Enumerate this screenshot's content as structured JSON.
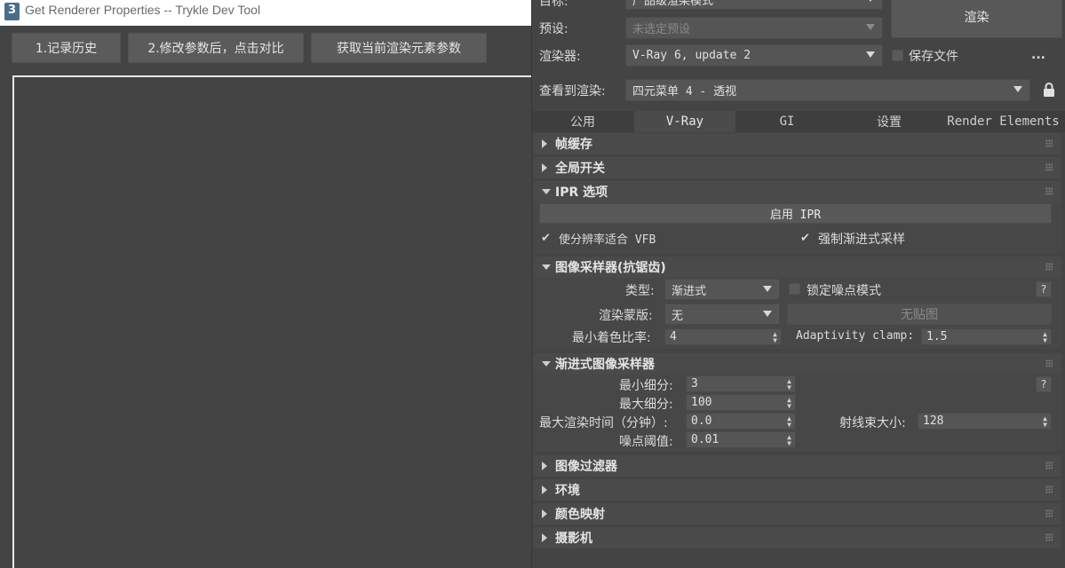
{
  "tool": {
    "title": "Get Renderer Properties -- Trykle Dev Tool",
    "buttons": [
      "1.记录历史",
      "2.修改参数后，点击对比",
      "获取当前渲染元素参数"
    ]
  },
  "render": {
    "target_label": "目标:",
    "target_value": "产品级渲染模式",
    "preset_label": "预设:",
    "preset_value": "未选定预设",
    "renderer_label": "渲染器:",
    "renderer_value": "V-Ray 6, update 2",
    "render_button": "渲染",
    "save_file_label": "保存文件",
    "more_label": "...",
    "view_label": "查看到渲染:",
    "view_value": "四元菜单 4 - 透视",
    "tabs": [
      "公用",
      "V-Ray",
      "GI",
      "设置",
      "Render Elements"
    ],
    "rollouts": {
      "frame_buffer": "帧缓存",
      "global_switches": "全局开关",
      "ipr_options": "IPR 选项",
      "image_sampler": "图像采样器(抗锯齿)",
      "progressive_sampler": "渐进式图像采样器",
      "image_filter": "图像过滤器",
      "environment": "环境",
      "color_mapping": "颜色映射",
      "camera": "摄影机"
    },
    "ipr": {
      "enable_button": "启用 IPR",
      "fit_vfb_label": "使分辨率适合 VFB",
      "force_progressive_label": "强制渐进式采样"
    },
    "sampler": {
      "type_label": "类型:",
      "type_value": "渐进式",
      "lock_noise_label": "锁定噪点模式",
      "mask_label": "渲染蒙版:",
      "mask_value": "无",
      "no_map_label": "无贴图",
      "min_shading_label": "最小着色比率:",
      "min_shading_value": "4",
      "adaptivity_label": "Adaptivity clamp:",
      "adaptivity_value": "1.5",
      "help": "?"
    },
    "progressive": {
      "min_subdivs_label": "最小细分:",
      "min_subdivs_value": "3",
      "max_subdivs_label": "最大细分:",
      "max_subdivs_value": "100",
      "max_time_label": "最大渲染时间（分钟）:",
      "max_time_value": "0.0",
      "bundle_label": "射线束大小:",
      "bundle_value": "128",
      "noise_label": "噪点阈值:",
      "noise_value": "0.01",
      "help": "?"
    }
  }
}
